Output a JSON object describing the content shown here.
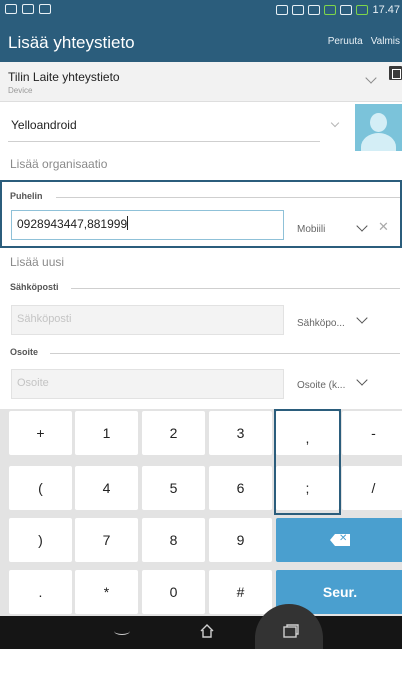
{
  "statusbar": {
    "time": "17.47"
  },
  "appbar": {
    "title": "Lisää yhteystieto",
    "cancel": "Peruuta",
    "done": "Valmis"
  },
  "account": {
    "title": "Tilin Laite yhteystieto",
    "subtitle": "Device"
  },
  "name": {
    "value": "Yelloandroid"
  },
  "organization": {
    "label": "Lisää organisaatio"
  },
  "phone": {
    "section": "Puhelin",
    "value": "0928943447,881999",
    "type": "Mobiili"
  },
  "add_new": {
    "label": "Lisää uusi"
  },
  "email": {
    "section": "Sähköposti",
    "placeholder": "Sähköposti",
    "type": "Sähköpo..."
  },
  "address": {
    "section": "Osoite",
    "placeholder": "Osoite",
    "type": "Osoite (k..."
  },
  "keyboard": {
    "row1": [
      "+",
      "1",
      "2",
      "3",
      ",",
      "-"
    ],
    "row2": [
      "(",
      "4",
      "5",
      "6",
      ";",
      "/"
    ],
    "row3": [
      ")",
      "7",
      "8",
      "9"
    ],
    "row4": [
      ".",
      "*",
      "0",
      "#"
    ],
    "next": "Seur.",
    "highlighted_key": ",;"
  },
  "colors": {
    "primary": "#2b5d7c",
    "accent": "#4a9fcf"
  }
}
